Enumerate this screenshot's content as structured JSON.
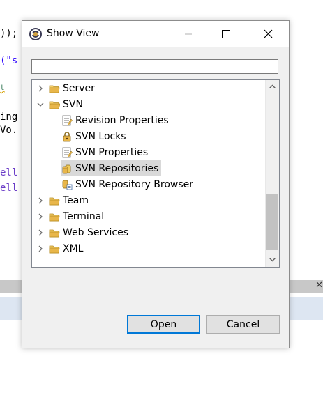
{
  "editor": {
    "lines": [
      {
        "text": "));",
        "color": "#000000"
      },
      {
        "text": "(\"s",
        "color": "#2a00ff"
      },
      {
        "text": "t ",
        "color": "#3f7f5f"
      },
      {
        "text": "ing",
        "color": "#000000"
      },
      {
        "text": "Vo.",
        "color": "#000000"
      },
      {
        "text": "ell",
        "color": "#6a3cc7"
      },
      {
        "text": "ell",
        "color": "#6a3cc7"
      }
    ],
    "close_glyph": "✕"
  },
  "dialog": {
    "title": "Show View",
    "filter": {
      "value": "",
      "placeholder": ""
    },
    "tree": [
      {
        "label": "Server",
        "icon": "folder-icon",
        "chevron": "collapsed"
      },
      {
        "label": "SVN",
        "icon": "folder-icon",
        "chevron": "expanded"
      },
      {
        "label": "Revision Properties",
        "icon": "properties-icon"
      },
      {
        "label": "SVN Locks",
        "icon": "lock-icon"
      },
      {
        "label": "SVN Properties",
        "icon": "properties-icon"
      },
      {
        "label": "SVN Repositories",
        "icon": "repositories-icon",
        "selected": true
      },
      {
        "label": "SVN Repository Browser",
        "icon": "repository-browser-icon"
      },
      {
        "label": "Team",
        "icon": "folder-icon",
        "chevron": "collapsed"
      },
      {
        "label": "Terminal",
        "icon": "folder-icon",
        "chevron": "collapsed"
      },
      {
        "label": "Web Services",
        "icon": "folder-icon",
        "chevron": "collapsed"
      },
      {
        "label": "XML",
        "icon": "folder-icon",
        "chevron": "collapsed"
      }
    ],
    "buttons": {
      "open": "Open",
      "cancel": "Cancel"
    },
    "colors": {
      "accent": "#0078d7",
      "selection": "#d9d9d9",
      "folder": "#e8b64a"
    }
  }
}
